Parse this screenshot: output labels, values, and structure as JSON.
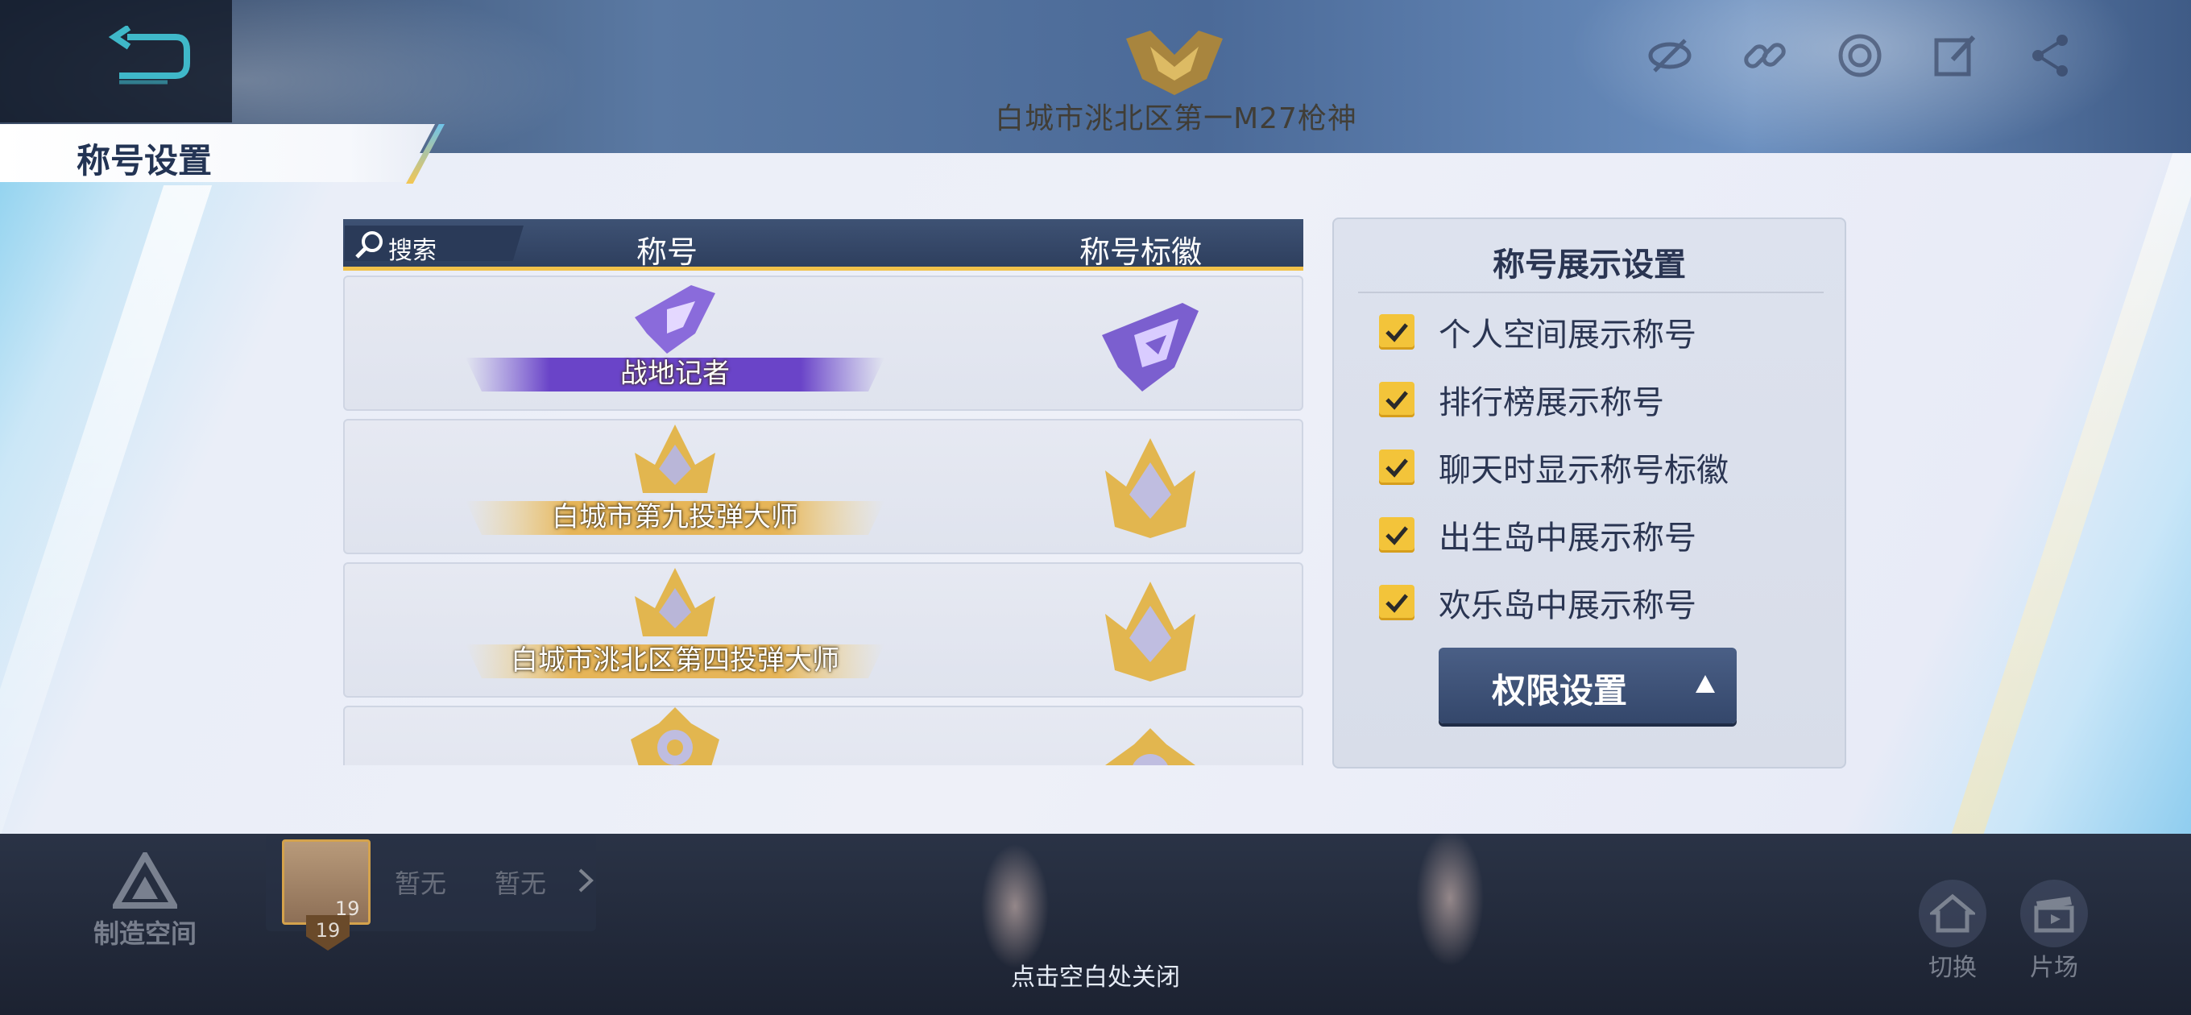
{
  "header": {
    "current_title": "白城市洮北区第一M27枪神",
    "peek_text": "称号设置"
  },
  "panel": {
    "title": "称号设置"
  },
  "title_list": {
    "search_placeholder": "搜索",
    "col_title": "称号",
    "col_badge": "称号标徽",
    "rows": [
      {
        "name": "战地记者",
        "theme": "purple",
        "badge_icon": "purple-g-badge-icon"
      },
      {
        "name": "白城市第九投弹大师",
        "theme": "gold",
        "badge_icon": "gold-crown-badge-icon"
      },
      {
        "name": "白城市洮北区第四投弹大师",
        "theme": "gold",
        "badge_icon": "gold-crown-badge-icon"
      },
      {
        "name": "",
        "theme": "gold",
        "badge_icon": "gold-target-badge-icon"
      }
    ]
  },
  "display_settings": {
    "title": "称号展示设置",
    "options": [
      {
        "label": "个人空间展示称号",
        "checked": true
      },
      {
        "label": "排行榜展示称号",
        "checked": true
      },
      {
        "label": "聊天时显示称号标徽",
        "checked": true
      },
      {
        "label": "出生岛中展示称号",
        "checked": true
      },
      {
        "label": "欢乐岛中展示称号",
        "checked": true
      }
    ],
    "permission_button": "权限设置"
  },
  "bottom": {
    "create_space": "制造空间",
    "friend_level": "19",
    "friend_slot1": "暂无",
    "friend_slot2": "暂无",
    "close_hint": "点击空白处关闭",
    "switch_label": "切换",
    "studio_label": "片场"
  },
  "colors": {
    "accent_gold": "#f2c24a",
    "header_navy": "#34476b",
    "checkbox_yellow": "#f3c43a"
  }
}
